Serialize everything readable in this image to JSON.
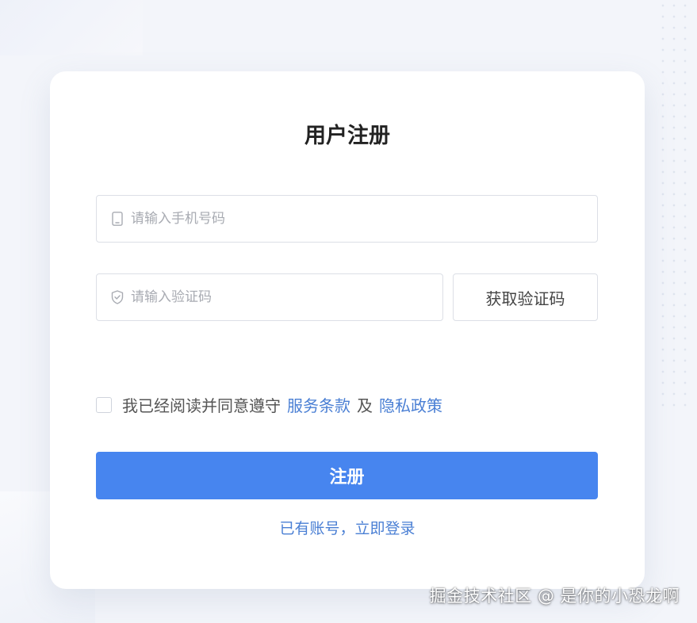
{
  "form": {
    "title": "用户注册",
    "phone": {
      "placeholder": "请输入手机号码",
      "value": "",
      "icon": "mobile-phone-icon"
    },
    "code": {
      "placeholder": "请输入验证码",
      "value": "",
      "icon": "shield-check-icon"
    },
    "get_code_label": "获取验证码",
    "agreement": {
      "checked": false,
      "text": "我已经阅读并同意遵守",
      "terms_link": "服务条款",
      "and": "及",
      "privacy_link": "隐私政策"
    },
    "submit_label": "注册",
    "login_link": "已有账号，立即登录"
  },
  "colors": {
    "primary": "#4785ef",
    "link": "#4a7fd4",
    "page_bg": "#f3f5fa"
  },
  "watermark": "掘金技术社区 @ 是你的小恐龙啊"
}
